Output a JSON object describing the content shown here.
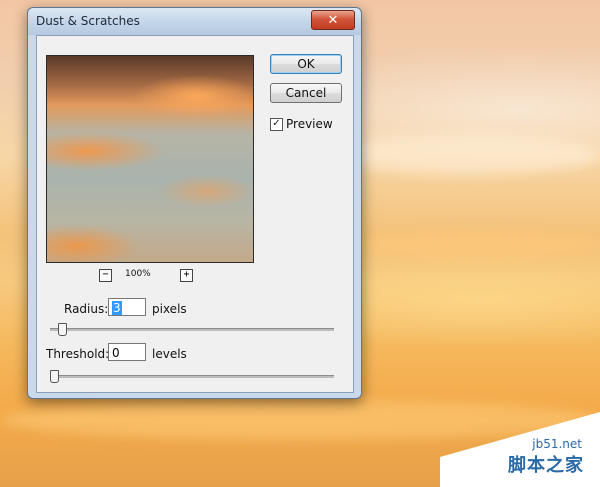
{
  "dialog": {
    "title": "Dust & Scratches",
    "close_glyph": "✕",
    "ok_label": "OK",
    "cancel_label": "Cancel",
    "preview_label": "Preview",
    "preview_checked": true,
    "zoom": {
      "out_glyph": "−",
      "in_glyph": "+",
      "level": "100%"
    },
    "radius": {
      "label": "Radius:",
      "value": "3",
      "unit": "pixels",
      "slider_fraction": 0.03
    },
    "threshold": {
      "label": "Threshold:",
      "value": "0",
      "unit": "levels",
      "slider_fraction": 0.0
    }
  },
  "watermark": {
    "site": "jb51.net",
    "name": "脚本之家"
  }
}
